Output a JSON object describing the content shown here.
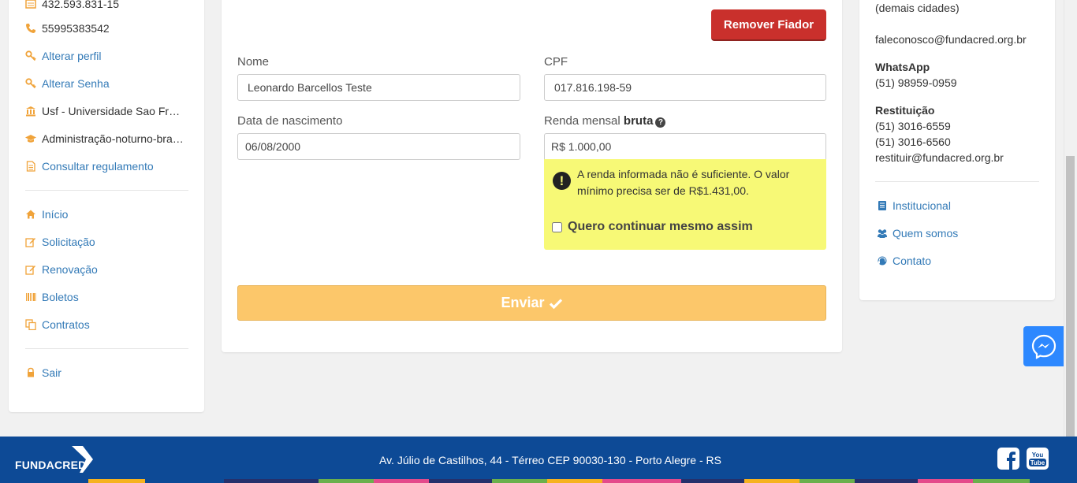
{
  "sidebar": {
    "items": [
      {
        "label": "432.593.831-15",
        "icon": "id-card-icon",
        "type": "plain"
      },
      {
        "label": "55995383542",
        "icon": "phone-icon",
        "type": "plain"
      },
      {
        "label": "Alterar perfil",
        "icon": "key-icon",
        "type": "link"
      },
      {
        "label": "Alterar Senha",
        "icon": "key-icon",
        "type": "link"
      },
      {
        "label": "Usf - Universidade Sao Francisco",
        "icon": "university-icon",
        "type": "plain"
      },
      {
        "label": "Administração-noturno-bragança",
        "icon": "graduation-cap-icon",
        "type": "plain"
      },
      {
        "label": "Consultar regulamento",
        "icon": "document-icon",
        "type": "link"
      },
      {
        "label": "Início",
        "icon": "home-icon",
        "type": "link"
      },
      {
        "label": "Solicitação",
        "icon": "edit-icon",
        "type": "link"
      },
      {
        "label": "Renovação",
        "icon": "edit-icon",
        "type": "link"
      },
      {
        "label": "Boletos",
        "icon": "barcode-icon",
        "type": "link"
      },
      {
        "label": "Contratos",
        "icon": "copy-icon",
        "type": "link"
      },
      {
        "label": "Sair",
        "icon": "lock-icon",
        "type": "link"
      }
    ]
  },
  "form": {
    "remove_button": "Remover Fiador",
    "name_label": "Nome",
    "name_value": "Leonardo Barcellos Teste",
    "cpf_label": "CPF",
    "cpf_value": "017.816.198-59",
    "birth_label": "Data de nascimento",
    "birth_value": "06/08/2000",
    "income_label": "Renda mensal ",
    "income_label_bold": "bruta",
    "income_help_icon": "question-circle-icon",
    "income_value": "R$ 1.000,00",
    "warning_text": "A renda informada não é suficiente. O valor mínimo precisa ser de R$1.431,00.",
    "warning_icon": "exclamation-circle-icon",
    "continue_checkbox_label": "Quero continuar mesmo assim",
    "submit_button": "Enviar",
    "submit_icon": "check-icon"
  },
  "contact": {
    "other_cities": "(demais cidades)",
    "email_contact": "faleconosco@fundacred.org.br",
    "whatsapp_title": "WhatsApp",
    "whatsapp_phone": "(51) 98959-0959",
    "refund_title": "Restituição",
    "refund_phone1": "(51) 3016-6559",
    "refund_phone2": "(51) 3016-6560",
    "refund_email": "restituir@fundacred.org.br",
    "links": [
      {
        "label": "Institucional",
        "icon": "book-icon"
      },
      {
        "label": "Quem somos",
        "icon": "users-icon"
      },
      {
        "label": "Contato",
        "icon": "headset-icon"
      }
    ]
  },
  "footer": {
    "brand": "FUNDACRED",
    "address": "Av. Júlio de Castilhos, 44 - Térreo CEP 90030-130 - Porto Alegre - RS",
    "social": [
      "facebook-icon",
      "youtube-icon"
    ]
  },
  "colors": {
    "primary_blue": "#0d4a96",
    "link": "#337ab7",
    "accent_orange": "#f0a33a",
    "danger": "#c9302c",
    "warning_bg": "#f7f976",
    "submit": "#fcc76a"
  }
}
